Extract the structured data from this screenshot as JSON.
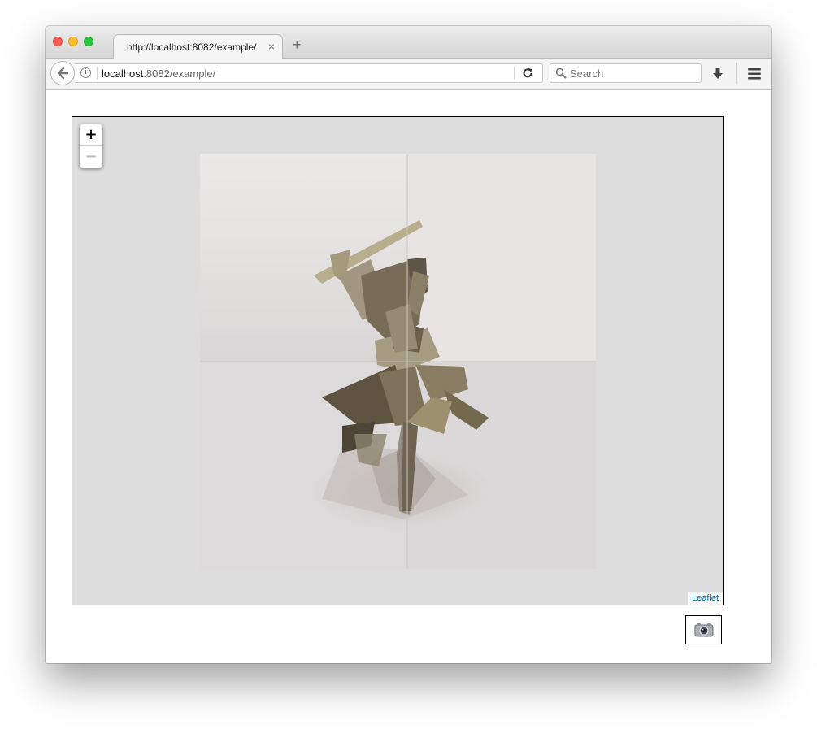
{
  "browser": {
    "tab_title": "http://localhost:8082/example/",
    "tab_close_glyph": "×",
    "new_tab_glyph": "+",
    "url_host": "localhost",
    "url_path": ":8082/example/",
    "search_placeholder": "Search",
    "info_glyph": "i"
  },
  "map": {
    "zoom_in_label": "+",
    "zoom_out_label": "−",
    "attribution": "Leaflet",
    "tile_grid": "2x2",
    "image_subject": "low-poly samurai figure with sword",
    "accent_color": "#0078a8"
  },
  "page": {
    "screenshot_button_icon": "camera-icon"
  }
}
